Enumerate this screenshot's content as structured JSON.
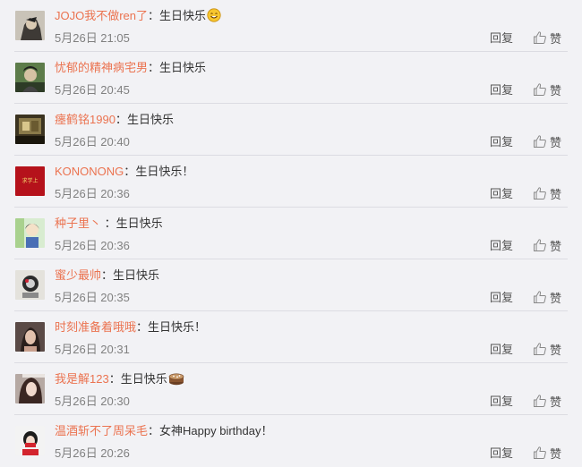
{
  "comments": [
    {
      "user": "JOJO我不做ren了",
      "colon": "：",
      "text": "生日快乐",
      "emoji": "smile-emoji",
      "time": "5月26日 21:05",
      "reply": "回复",
      "like": "赞"
    },
    {
      "user": "忧郁的精神病宅男",
      "colon": "：",
      "text": "生日快乐",
      "time": "5月26日 20:45",
      "reply": "回复",
      "like": "赞"
    },
    {
      "user": "瘗鹤铭1990",
      "colon": "：",
      "text": "生日快乐",
      "time": "5月26日 20:40",
      "reply": "回复",
      "like": "赞"
    },
    {
      "user": "KONONONG",
      "colon": "：",
      "text": "生日快乐！",
      "time": "5月26日 20:36",
      "reply": "回复",
      "like": "赞",
      "avatar_text": "求学上"
    },
    {
      "user": "种子里丶",
      "colon": " ：",
      "text": "生日快乐",
      "time": "5月26日 20:36",
      "reply": "回复",
      "like": "赞"
    },
    {
      "user": "蜜少最帅",
      "colon": "：",
      "text": "生日快乐",
      "time": "5月26日 20:35",
      "reply": "回复",
      "like": "赞"
    },
    {
      "user": "时刻准备着哦哦",
      "colon": "：",
      "text": "生日快乐！",
      "time": "5月26日 20:31",
      "reply": "回复",
      "like": "赞"
    },
    {
      "user": "我是解123",
      "colon": "：",
      "text": "生日快乐",
      "emoji": "cake-emoji",
      "time": "5月26日 20:30",
      "reply": "回复",
      "like": "赞"
    },
    {
      "user": "温酒斩不了周呆毛",
      "colon": "：",
      "text": "女神Happy birthday！",
      "time": "5月26日 20:26",
      "reply": "回复",
      "like": "赞"
    }
  ],
  "colors": {
    "username": "#eb7350",
    "time": "#808080",
    "background": "#f2f2f5"
  }
}
